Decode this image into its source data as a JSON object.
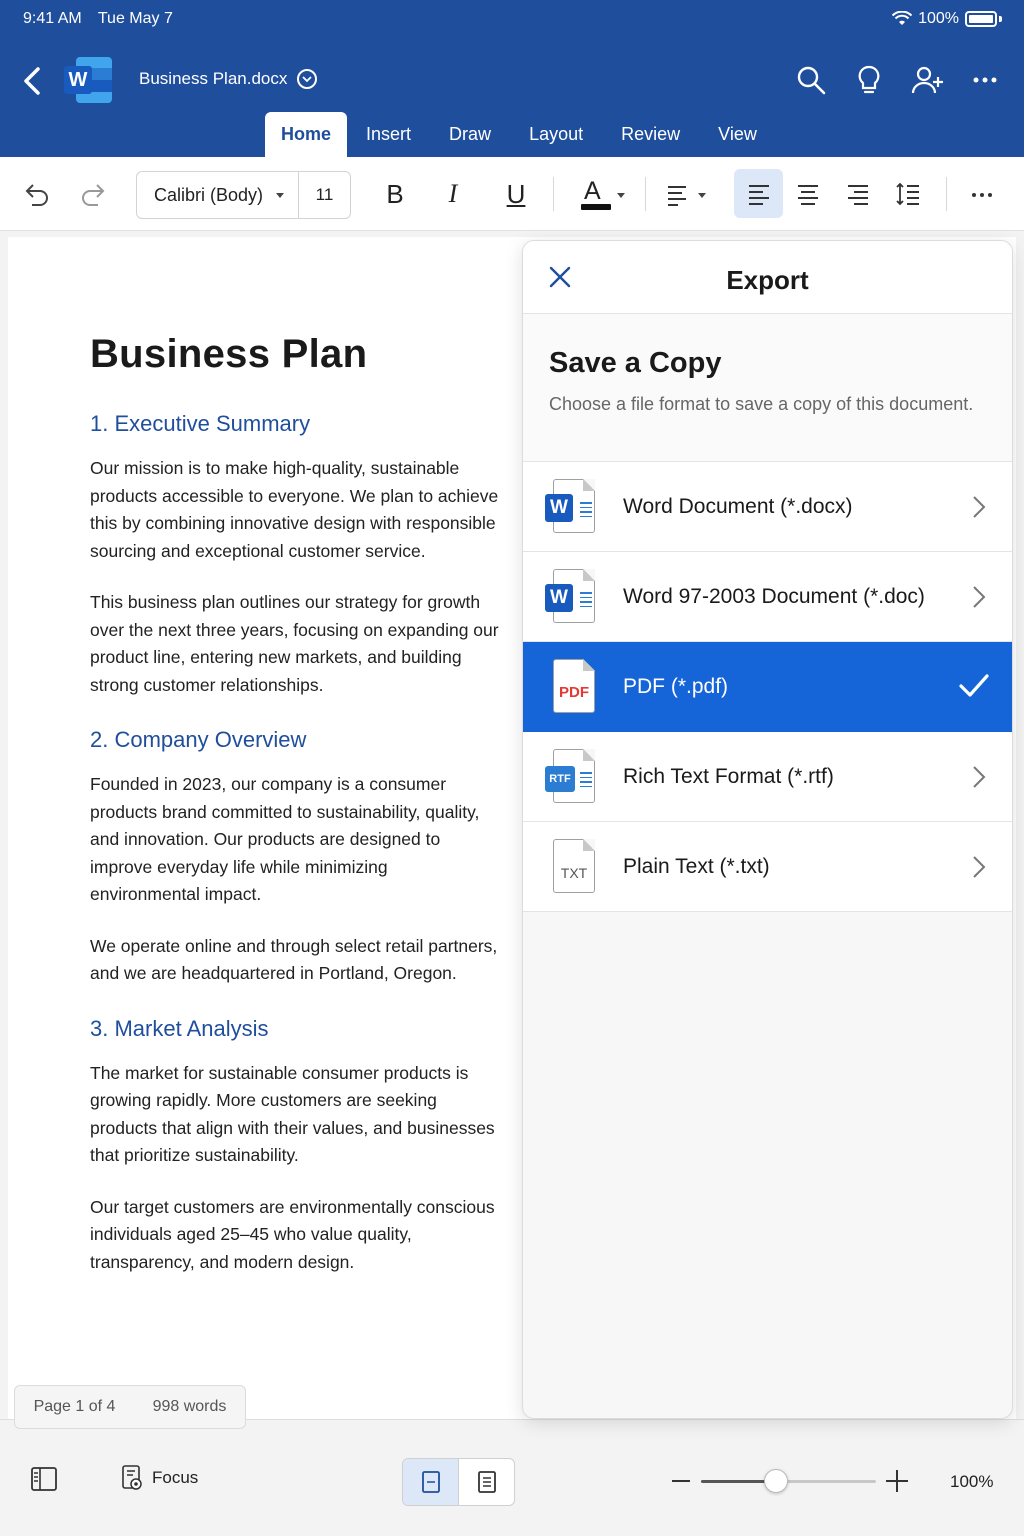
{
  "status": {
    "time": "9:41 AM",
    "date": "Tue May 7",
    "battery": "100%"
  },
  "header": {
    "doc_title": "Business Plan.docx",
    "tabs": [
      {
        "label": "Home",
        "active": true
      },
      {
        "label": "Insert"
      },
      {
        "label": "Draw"
      },
      {
        "label": "Layout"
      },
      {
        "label": "Review"
      },
      {
        "label": "View"
      }
    ],
    "icons": [
      "back-chevron-icon",
      "search-icon",
      "lightbulb-icon",
      "share-person-icon",
      "more-icon"
    ]
  },
  "toolbar": {
    "font_name": "Calibri (Body)",
    "font_size": "11",
    "bold": "B",
    "italic": "I",
    "underline": "U",
    "font_color_letter": "A"
  },
  "document": {
    "title": "Business Plan",
    "sections": [
      {
        "heading": "1. Executive Summary",
        "paragraphs": [
          "Our mission is to make high-quality, sustainable products accessible to everyone. We plan to achieve this by combining innovative design with responsible sourcing and exceptional customer service.",
          "This business plan outlines our strategy for growth over the next three years, focusing on expanding our product line, entering new markets, and building strong customer relationships."
        ]
      },
      {
        "heading": "2. Company Overview",
        "paragraphs": [
          "Founded in 2023, our company is a consumer products brand committed to sustainability, quality, and innovation. Our products are designed to improve everyday life while minimizing environmental impact.",
          "We operate online and through select retail partners, and we are headquartered in Portland, Oregon."
        ]
      },
      {
        "heading": "3. Market Analysis",
        "paragraphs": [
          "The market for sustainable consumer products is growing rapidly. More customers are seeking products that align with their values, and businesses that prioritize sustainability.",
          "Our target customers are environmentally conscious individuals aged 25–45 who value quality, transparency, and modern design."
        ]
      }
    ],
    "page_info": "Page 1 of 4",
    "word_count": "998 words"
  },
  "export_panel": {
    "title": "Export",
    "save_title": "Save a Copy",
    "save_desc": "Choose a file format to save a copy of this document.",
    "formats": [
      {
        "label": "Word Document (*.docx)",
        "icon": "word-doc-icon",
        "badge": "W"
      },
      {
        "label": "Word 97-2003 Document (*.doc)",
        "icon": "word-doc-icon",
        "badge": "W"
      },
      {
        "label": "PDF (*.pdf)",
        "icon": "pdf-icon",
        "badge": "PDF",
        "selected": true
      },
      {
        "label": "Rich Text Format (*.rtf)",
        "icon": "rtf-icon",
        "badge": "RTF"
      },
      {
        "label": "Plain Text (*.txt)",
        "icon": "txt-icon",
        "badge": "TXT"
      }
    ]
  },
  "bottombar": {
    "focus_label": "Focus",
    "zoom_label": "100%",
    "zoom_level": 0.43
  },
  "colors": {
    "header_bg": "#1f4e9c",
    "accent": "#1565d8",
    "heading_blue": "#1f4e9c"
  }
}
